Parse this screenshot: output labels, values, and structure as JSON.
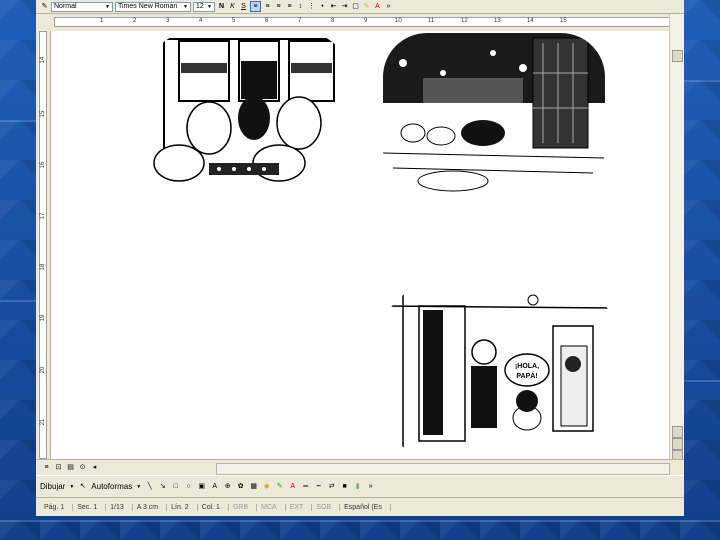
{
  "toolbar": {
    "style_value": "Normal",
    "font_value": "Times New Roman",
    "size_value": "12",
    "bold_label": "N",
    "italic_label": "K",
    "underline_label": "S"
  },
  "ruler": {
    "h_numbers": [
      "1",
      "2",
      "3",
      "4",
      "5",
      "6",
      "7",
      "8",
      "9",
      "10",
      "11",
      "12",
      "13",
      "14",
      "15"
    ],
    "v_numbers": [
      "14",
      "15",
      "16",
      "17",
      "18",
      "19",
      "20",
      "21"
    ]
  },
  "drawing_toolbar": {
    "draw_label": "Dibujar",
    "autoshapes_label": "Autoformas"
  },
  "status_bar": {
    "page": "Pág. 1",
    "section": "Sec. 1",
    "pages": "1/13",
    "at": "A 3 cm",
    "line": "Lín. 2",
    "col": "Col. 1",
    "rec": "GRB",
    "track": "MCA",
    "ext": "EXT",
    "ovr": "SOB",
    "language": "Español (Es"
  },
  "comic": {
    "speech_bubble_line1": "¡HOLA,",
    "speech_bubble_line2": "PAPÁ!"
  }
}
